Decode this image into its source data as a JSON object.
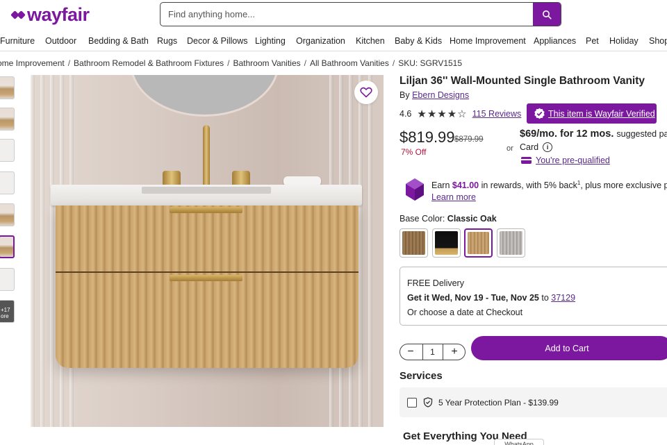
{
  "brand": {
    "name": "wayfair",
    "color": "#7b189f"
  },
  "search": {
    "placeholder": "Find anything home...",
    "icon": "search-icon"
  },
  "nav": [
    "Furniture",
    "Outdoor",
    "Bedding & Bath",
    "Rugs",
    "Decor & Pillows",
    "Lighting",
    "Organization",
    "Kitchen",
    "Baby & Kids",
    "Home Improvement",
    "Appliances",
    "Pet",
    "Holiday",
    "Shop"
  ],
  "breadcrumb": [
    "ome Improvement",
    "Bathroom Remodel & Bathroom Fixtures",
    "Bathroom Vanities",
    "All Bathroom Vanities",
    "SKU: SGRV1515"
  ],
  "thumbnails": {
    "more_label_1": "+17",
    "more_label_2": "ore"
  },
  "product": {
    "title": "Liljan 36'' Wall-Mounted Single Bathroom Vanity",
    "by_label": "By",
    "brand": "Ebern Designs",
    "rating": "4.6",
    "stars": "★★★★☆",
    "reviews": "115 Reviews",
    "verified": "This item is Wayfair Verified"
  },
  "pricing": {
    "price": "$819.99",
    "old_price": "$879.99",
    "discount": "7% Off",
    "or": "or",
    "monthly": "$69/mo. for 12 mos.",
    "suggested": "suggested payn",
    "card": "Card",
    "prequalified": "You're pre-qualified"
  },
  "rewards": {
    "earn": "Earn",
    "amount": "$41.00",
    "rest": "in rewards, with 5% back",
    "sup": "1",
    "tail": ", plus more exclusive perks",
    "learn_more": "Learn more"
  },
  "color": {
    "label": "Base Color:",
    "selected": "Classic Oak",
    "swatches": [
      "Dark Walnut",
      "Black",
      "Classic Oak",
      "Grey"
    ]
  },
  "delivery": {
    "free": "FREE Delivery",
    "get_it": "Get it Wed, Nov 19 - Tue, Nov 25",
    "to": "to",
    "zip": "37129",
    "choose": "Or choose a date at Checkout"
  },
  "cart": {
    "qty": "1",
    "minus": "−",
    "plus": "+",
    "add_label": "Add to Cart"
  },
  "services": {
    "heading": "Services",
    "protection": "5 Year Protection Plan - $139.99"
  },
  "bottom": {
    "heading": "Get Everything You Need",
    "whatsapp": "WhatsApp"
  }
}
